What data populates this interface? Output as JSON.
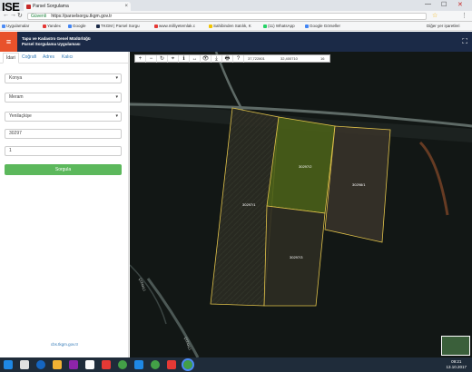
{
  "overlay_label": "ISE",
  "tab": {
    "title": "Parsel Sorgulama",
    "close": "×"
  },
  "window_controls": {
    "minimize": "—",
    "maximize": "☐",
    "close": "✕"
  },
  "address": {
    "secure_label": "Güvenli",
    "url": "https://parselsorgu.tkgm.gov.tr"
  },
  "bookmarks": [
    {
      "label": "Uygulamalar",
      "color": "#4c8bf5"
    },
    {
      "label": "Yandex",
      "color": "#e53935"
    },
    {
      "label": "Google",
      "color": "#4285f4"
    },
    {
      "label": "TKGM | Parsel Sorgu",
      "color": "#1b2a47"
    },
    {
      "label": "www.milliyetemlak.c",
      "color": "#e53935"
    },
    {
      "label": "Sahibinden Satılık, K",
      "color": "#f2c500"
    },
    {
      "label": "(11) WhatsApp",
      "color": "#25d366"
    },
    {
      "label": "Google Görseller",
      "color": "#4285f4"
    }
  ],
  "bookmark_other": "Diğer yer işaretleri",
  "app": {
    "title_line1": "Tapu ve Kadastro Genel Müdürlüğü",
    "title_line2": "Parsel Sorgulama Uygulaması",
    "menu_icon": "≡",
    "fullscreen_icon": "⛶"
  },
  "sidebar": {
    "tabs": [
      "İdari",
      "Coğrafi",
      "Adres",
      "Kalıcı"
    ],
    "il": "Konya",
    "ilce": "Meram",
    "mahalle": "Yenilaçkişe",
    "ada": "30297",
    "parsel": "1",
    "submit": "Sorgula",
    "footer": "cbs.tkgm.gov.tr"
  },
  "map": {
    "toolbar_icons": [
      "+",
      "−",
      "↻",
      "⌖",
      "ℹ",
      "↔",
      "👁",
      "⤓",
      "🖶",
      "?"
    ],
    "coord_x": "37,722801",
    "coord_y": "32,400710",
    "coord_extra": "16",
    "parcel_labels": [
      "30297/1",
      "30297/2",
      "30297/3",
      "30298/1"
    ],
    "road_labels": [
      "ÇITAKLI",
      "ÇITAKLI"
    ],
    "attribution": "Google"
  },
  "taskbar": {
    "time": "09:21",
    "date": "13.10.2017"
  }
}
